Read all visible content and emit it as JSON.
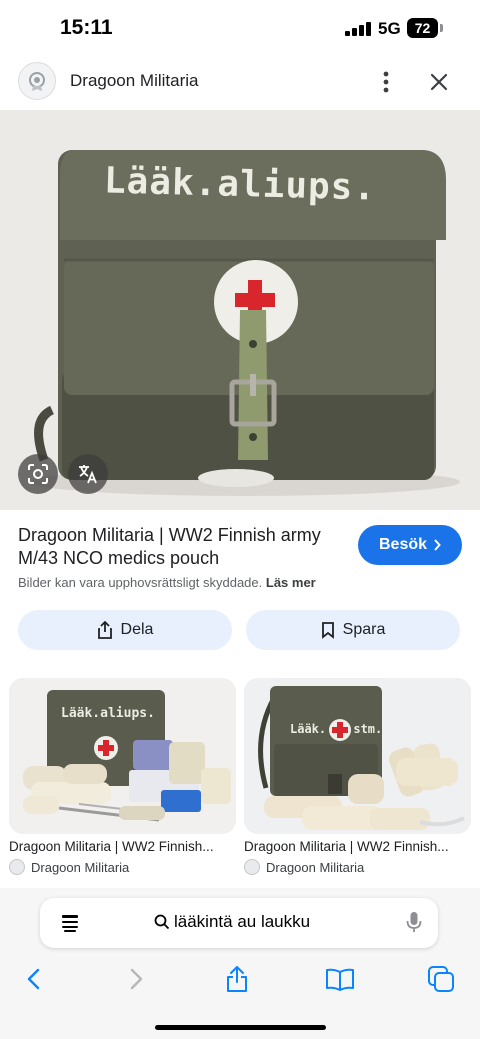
{
  "status_bar": {
    "time": "15:11",
    "network": "5G",
    "battery": "72"
  },
  "header": {
    "site_name": "Dragoon Militaria"
  },
  "main_image": {
    "stencil_text": "Lääk.aliups."
  },
  "result": {
    "title_line1": "Dragoon Militaria | WW2 Finnish army",
    "title_line2": "M/43 NCO medics pouch",
    "visit_label": "Besök",
    "copyright": "Bilder kan vara upphovsrättsligt skyddade.",
    "learn_more": "Läs mer",
    "share_label": "Dela",
    "save_label": "Spara"
  },
  "related": [
    {
      "title": "Dragoon Militaria | WW2 Finnish...",
      "source": "Dragoon Militaria",
      "stencil": "Lääk.aliups."
    },
    {
      "title": "Dragoon Militaria | WW2 Finnish...",
      "source": "Dragoon Militaria",
      "stencil": "Lääk. stm."
    }
  ],
  "safari": {
    "query": "lääkintä au laukku"
  },
  "colors": {
    "accent": "#1a73e8",
    "tonal_button": "#e8f0fe",
    "safari_blue": "#0a84ff"
  },
  "icons": [
    "settings-badge-icon",
    "more-vert-icon",
    "close-icon",
    "lens-icon",
    "translate-icon",
    "chevron-right-icon",
    "share-icon",
    "bookmark-icon",
    "reader-icon",
    "search-icon",
    "mic-icon",
    "back-icon",
    "forward-icon",
    "share-sheet-icon",
    "bookmarks-icon",
    "tabs-icon"
  ]
}
